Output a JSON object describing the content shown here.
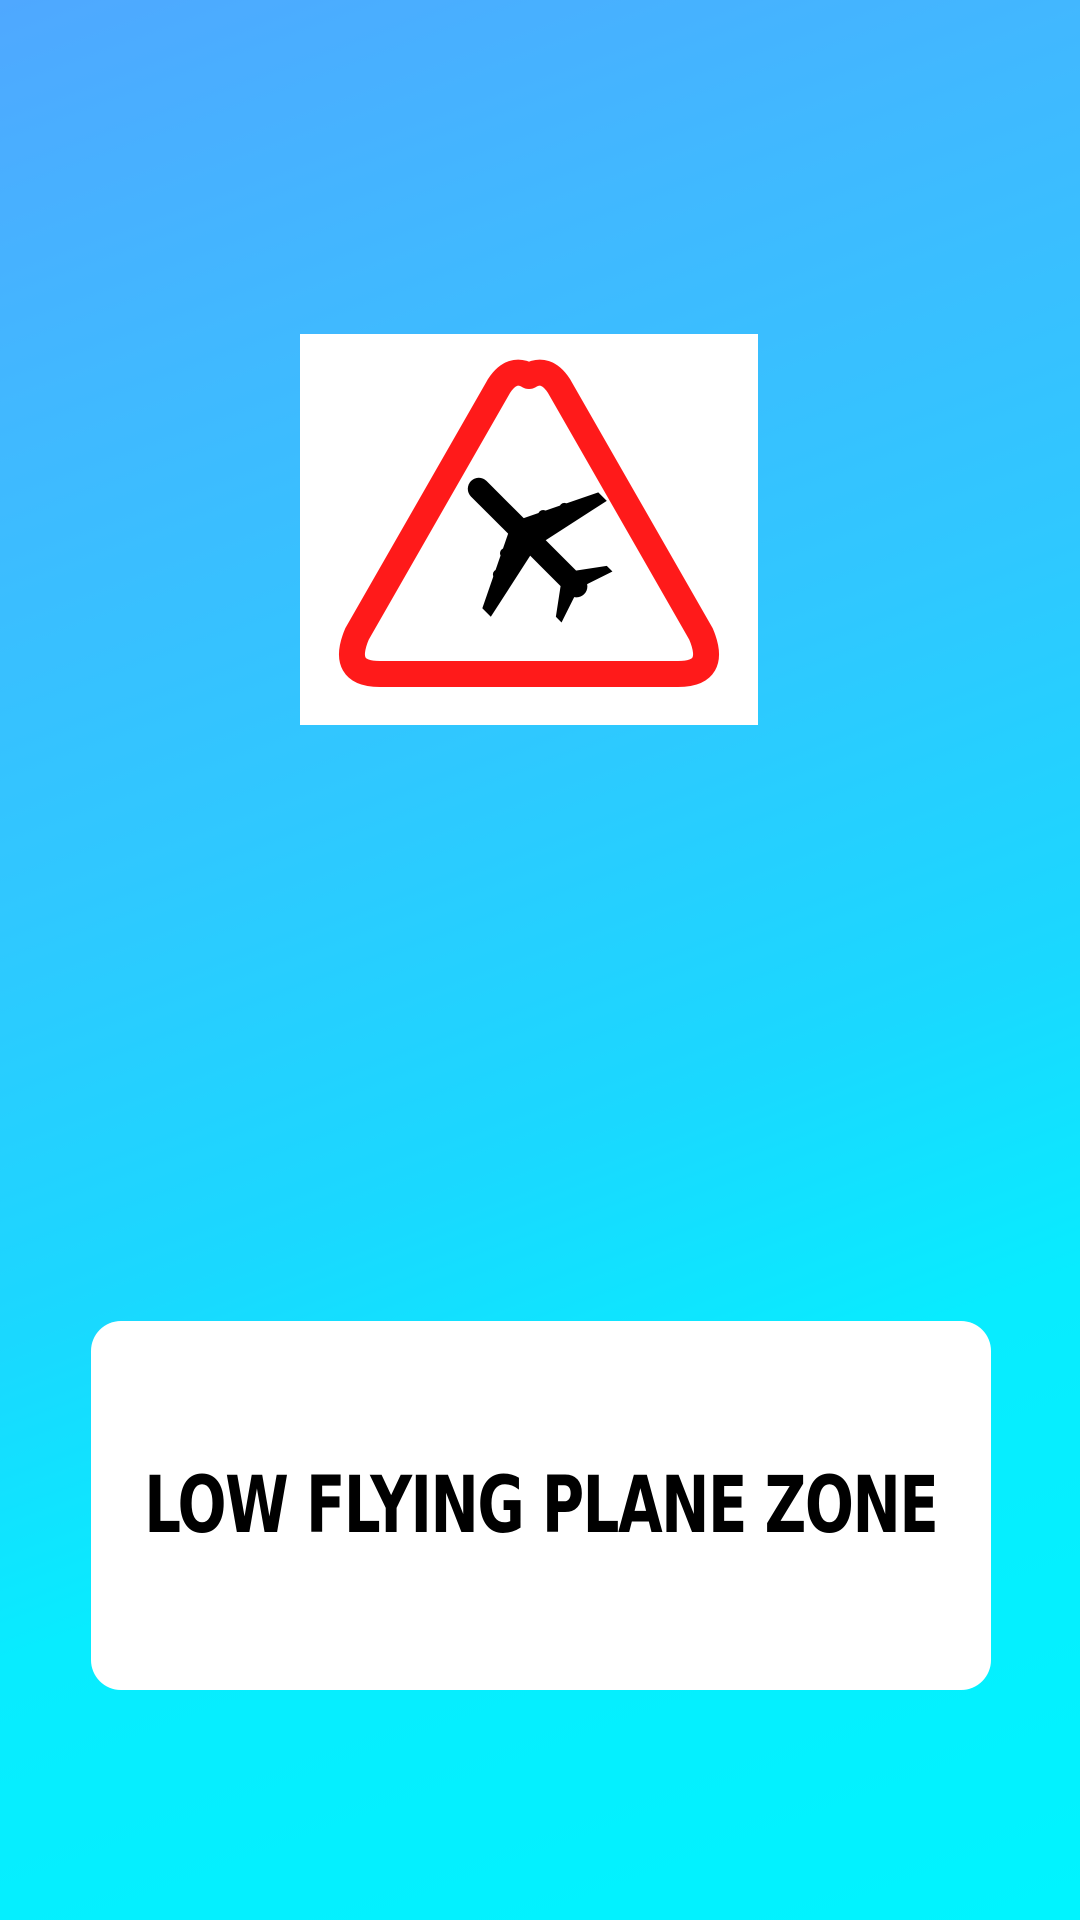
{
  "sign": {
    "icon": "low-flying-aircraft-warning-sign",
    "border_color": "#ff1a1a",
    "symbol_color": "#000000"
  },
  "caption": {
    "text": "LOW FLYING PLANE ZONE"
  },
  "colors": {
    "background_top": "#4fa8ff",
    "background_bottom": "#00f4ff",
    "card": "#ffffff"
  }
}
